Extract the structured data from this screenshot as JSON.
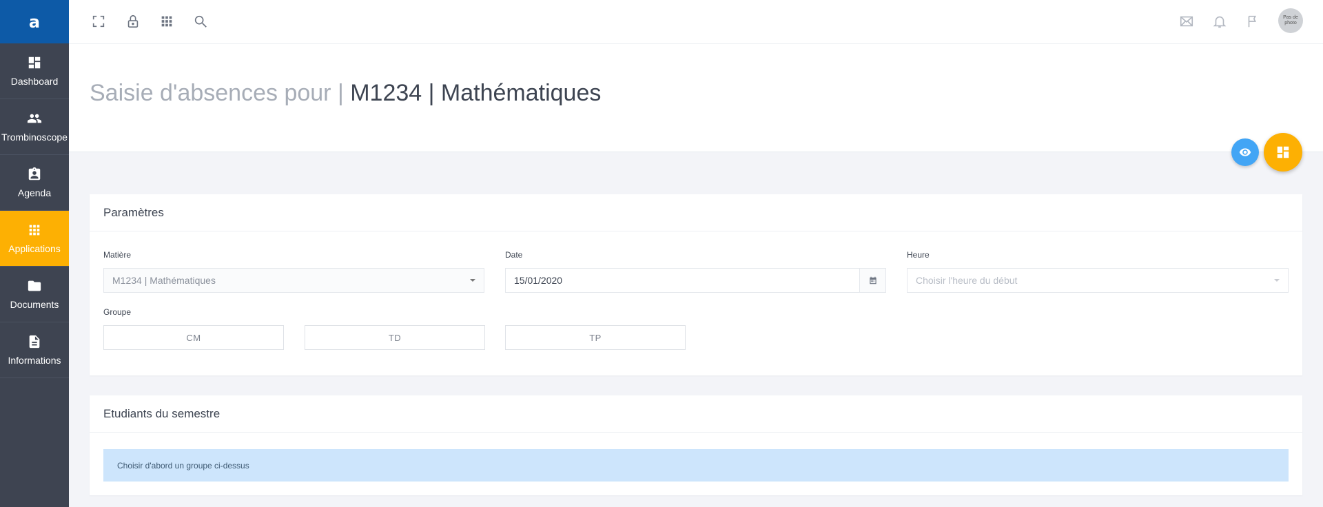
{
  "brand": {
    "letter": "a"
  },
  "sidebar": {
    "items": [
      {
        "label": "Dashboard",
        "icon": "dashboard-icon",
        "active": false
      },
      {
        "label": "Trombinoscope",
        "icon": "people-icon",
        "active": false
      },
      {
        "label": "Agenda",
        "icon": "agenda-icon",
        "active": false
      },
      {
        "label": "Applications",
        "icon": "apps-grid-icon",
        "active": true
      },
      {
        "label": "Documents",
        "icon": "folder-icon",
        "active": false
      },
      {
        "label": "Informations",
        "icon": "file-icon",
        "active": false
      }
    ]
  },
  "topbar": {
    "left_icons": [
      "fullscreen-icon",
      "lock-icon",
      "grid-icon",
      "search-icon"
    ],
    "right_icons": [
      "mail-icon",
      "bell-icon",
      "flag-icon"
    ],
    "avatar_text": "Pas de photo"
  },
  "header": {
    "title_prefix": "Saisie d'absences pour |",
    "title_main": "M1234 | Mathématiques"
  },
  "params": {
    "title": "Paramètres",
    "matiere_label": "Matière",
    "matiere_value": "M1234 | Mathématiques",
    "date_label": "Date",
    "date_value": "15/01/2020",
    "heure_label": "Heure",
    "heure_placeholder": "Choisir l'heure du début",
    "groupe_label": "Groupe",
    "groups": [
      "CM",
      "TD",
      "TP"
    ]
  },
  "students": {
    "title": "Etudiants du semestre",
    "alert": "Choisir d'abord un groupe ci-dessus"
  },
  "colors": {
    "brand_blue": "#0d5aa7",
    "accent_yellow": "#fdb003",
    "sidebar_bg": "#3e4451",
    "info_blue": "#42a5f5"
  }
}
